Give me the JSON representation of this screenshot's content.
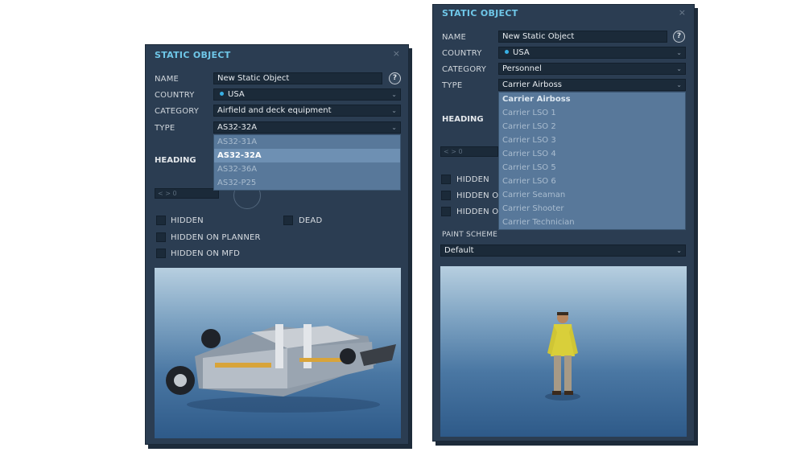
{
  "left_panel": {
    "title": "STATIC OBJECT",
    "close_glyph": "×",
    "name_label": "NAME",
    "name_value": "New Static Object",
    "help_glyph": "?",
    "country_label": "COUNTRY",
    "country_value": "USA",
    "category_label": "CATEGORY",
    "category_value": "Airfield and deck equipment",
    "type_label": "TYPE",
    "type_value": "AS32-32A",
    "type_options": [
      "AS32-31A",
      "AS32-32A",
      "AS32-36A",
      "AS32-P25"
    ],
    "type_selected": "AS32-32A",
    "heading_label": "HEADING",
    "heading_stepper": "< > 0",
    "hidden_label": "HIDDEN",
    "dead_label": "DEAD",
    "hidden_planner_label": "HIDDEN ON PLANNER",
    "hidden_mfd_label": "HIDDEN ON MFD"
  },
  "right_panel": {
    "title": "STATIC OBJECT",
    "close_glyph": "×",
    "name_label": "NAME",
    "name_value": "New Static Object",
    "help_glyph": "?",
    "country_label": "COUNTRY",
    "country_value": "USA",
    "category_label": "CATEGORY",
    "category_value": "Personnel",
    "type_label": "TYPE",
    "type_value": "Carrier Airboss",
    "type_options": [
      "Carrier Airboss",
      "Carrier LSO 1",
      "Carrier LSO 2",
      "Carrier LSO 3",
      "Carrier LSO 4",
      "Carrier LSO 5",
      "Carrier LSO 6",
      "Carrier Seaman",
      "Carrier Shooter",
      "Carrier Technician"
    ],
    "type_selected": "Carrier Airboss",
    "heading_label": "HEADING",
    "heading_stepper": "< > 0",
    "hidden_label": "HIDDEN",
    "hidden_planner_partial": "HIDDEN O",
    "hidden_mfd_partial": "HIDDEN O",
    "paint_scheme_label": "PAINT SCHEME",
    "paint_scheme_value": "Default"
  },
  "colors": {
    "panel_bg": "#2b3d52",
    "title_accent": "#6fc7e8",
    "field_bg": "#1b2a39",
    "dropdown_bg": "#58789a",
    "dropdown_highlight": "#6e90b3",
    "country_dot": "#38b0e5"
  },
  "icons": {
    "close": "close-icon",
    "help": "help-icon",
    "chevron": "chevron-down-icon",
    "country_flag": "country-dot-icon"
  }
}
